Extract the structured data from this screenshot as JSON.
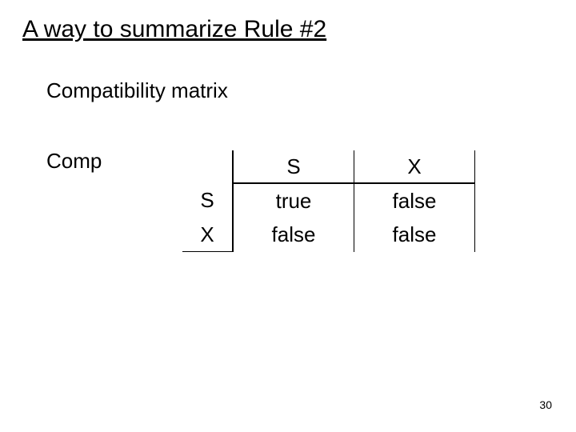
{
  "title": "A way to summarize Rule #2",
  "subtitle": "Compatibility matrix",
  "label": "Comp",
  "table": {
    "colHeaders": [
      "S",
      "X"
    ],
    "rowHeaders": [
      "S",
      "X"
    ],
    "cells": [
      [
        "true",
        "false"
      ],
      [
        "false",
        "false"
      ]
    ]
  },
  "pageNumber": "30",
  "chart_data": {
    "type": "table",
    "title": "Compatibility matrix (Comp)",
    "columns": [
      "S",
      "X"
    ],
    "rows": [
      "S",
      "X"
    ],
    "values": [
      [
        "true",
        "false"
      ],
      [
        "false",
        "false"
      ]
    ]
  }
}
